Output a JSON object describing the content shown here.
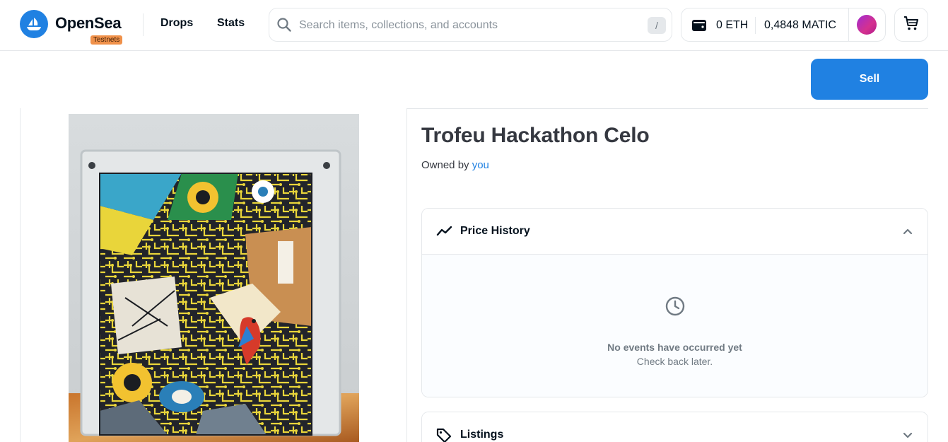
{
  "header": {
    "brand": "OpenSea",
    "badge": "Testnets",
    "nav": {
      "drops": "Drops",
      "stats": "Stats"
    },
    "search": {
      "placeholder": "Search items, collections, and accounts",
      "shortcut": "/"
    },
    "wallet": {
      "eth": "0 ETH",
      "matic": "0,4848 MATIC"
    }
  },
  "actions": {
    "sell": "Sell"
  },
  "item": {
    "title": "Trofeu Hackathon Celo",
    "owned_by_prefix": "Owned by",
    "owner": "you"
  },
  "price_history": {
    "title": "Price History",
    "empty_title": "No events have occurred yet",
    "empty_subtitle": "Check back later."
  },
  "listings": {
    "title": "Listings"
  },
  "colors": {
    "accent": "#2081e2",
    "badge": "#f0914a",
    "text": "#04111d"
  },
  "icons": [
    "opensea-logo-icon",
    "search-icon",
    "wallet-icon",
    "cart-icon",
    "trend-line-icon",
    "chevron-up-icon",
    "clock-icon",
    "tag-icon",
    "chevron-down-icon"
  ]
}
